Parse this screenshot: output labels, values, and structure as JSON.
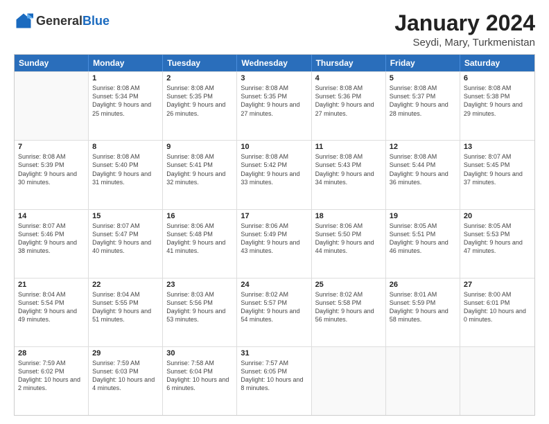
{
  "header": {
    "logo_general": "General",
    "logo_blue": "Blue",
    "month_title": "January 2024",
    "location": "Seydi, Mary, Turkmenistan"
  },
  "days_of_week": [
    "Sunday",
    "Monday",
    "Tuesday",
    "Wednesday",
    "Thursday",
    "Friday",
    "Saturday"
  ],
  "rows": [
    [
      {
        "day": "",
        "sunrise": "",
        "sunset": "",
        "daylight": ""
      },
      {
        "day": "1",
        "sunrise": "Sunrise: 8:08 AM",
        "sunset": "Sunset: 5:34 PM",
        "daylight": "Daylight: 9 hours and 25 minutes."
      },
      {
        "day": "2",
        "sunrise": "Sunrise: 8:08 AM",
        "sunset": "Sunset: 5:35 PM",
        "daylight": "Daylight: 9 hours and 26 minutes."
      },
      {
        "day": "3",
        "sunrise": "Sunrise: 8:08 AM",
        "sunset": "Sunset: 5:35 PM",
        "daylight": "Daylight: 9 hours and 27 minutes."
      },
      {
        "day": "4",
        "sunrise": "Sunrise: 8:08 AM",
        "sunset": "Sunset: 5:36 PM",
        "daylight": "Daylight: 9 hours and 27 minutes."
      },
      {
        "day": "5",
        "sunrise": "Sunrise: 8:08 AM",
        "sunset": "Sunset: 5:37 PM",
        "daylight": "Daylight: 9 hours and 28 minutes."
      },
      {
        "day": "6",
        "sunrise": "Sunrise: 8:08 AM",
        "sunset": "Sunset: 5:38 PM",
        "daylight": "Daylight: 9 hours and 29 minutes."
      }
    ],
    [
      {
        "day": "7",
        "sunrise": "Sunrise: 8:08 AM",
        "sunset": "Sunset: 5:39 PM",
        "daylight": "Daylight: 9 hours and 30 minutes."
      },
      {
        "day": "8",
        "sunrise": "Sunrise: 8:08 AM",
        "sunset": "Sunset: 5:40 PM",
        "daylight": "Daylight: 9 hours and 31 minutes."
      },
      {
        "day": "9",
        "sunrise": "Sunrise: 8:08 AM",
        "sunset": "Sunset: 5:41 PM",
        "daylight": "Daylight: 9 hours and 32 minutes."
      },
      {
        "day": "10",
        "sunrise": "Sunrise: 8:08 AM",
        "sunset": "Sunset: 5:42 PM",
        "daylight": "Daylight: 9 hours and 33 minutes."
      },
      {
        "day": "11",
        "sunrise": "Sunrise: 8:08 AM",
        "sunset": "Sunset: 5:43 PM",
        "daylight": "Daylight: 9 hours and 34 minutes."
      },
      {
        "day": "12",
        "sunrise": "Sunrise: 8:08 AM",
        "sunset": "Sunset: 5:44 PM",
        "daylight": "Daylight: 9 hours and 36 minutes."
      },
      {
        "day": "13",
        "sunrise": "Sunrise: 8:07 AM",
        "sunset": "Sunset: 5:45 PM",
        "daylight": "Daylight: 9 hours and 37 minutes."
      }
    ],
    [
      {
        "day": "14",
        "sunrise": "Sunrise: 8:07 AM",
        "sunset": "Sunset: 5:46 PM",
        "daylight": "Daylight: 9 hours and 38 minutes."
      },
      {
        "day": "15",
        "sunrise": "Sunrise: 8:07 AM",
        "sunset": "Sunset: 5:47 PM",
        "daylight": "Daylight: 9 hours and 40 minutes."
      },
      {
        "day": "16",
        "sunrise": "Sunrise: 8:06 AM",
        "sunset": "Sunset: 5:48 PM",
        "daylight": "Daylight: 9 hours and 41 minutes."
      },
      {
        "day": "17",
        "sunrise": "Sunrise: 8:06 AM",
        "sunset": "Sunset: 5:49 PM",
        "daylight": "Daylight: 9 hours and 43 minutes."
      },
      {
        "day": "18",
        "sunrise": "Sunrise: 8:06 AM",
        "sunset": "Sunset: 5:50 PM",
        "daylight": "Daylight: 9 hours and 44 minutes."
      },
      {
        "day": "19",
        "sunrise": "Sunrise: 8:05 AM",
        "sunset": "Sunset: 5:51 PM",
        "daylight": "Daylight: 9 hours and 46 minutes."
      },
      {
        "day": "20",
        "sunrise": "Sunrise: 8:05 AM",
        "sunset": "Sunset: 5:53 PM",
        "daylight": "Daylight: 9 hours and 47 minutes."
      }
    ],
    [
      {
        "day": "21",
        "sunrise": "Sunrise: 8:04 AM",
        "sunset": "Sunset: 5:54 PM",
        "daylight": "Daylight: 9 hours and 49 minutes."
      },
      {
        "day": "22",
        "sunrise": "Sunrise: 8:04 AM",
        "sunset": "Sunset: 5:55 PM",
        "daylight": "Daylight: 9 hours and 51 minutes."
      },
      {
        "day": "23",
        "sunrise": "Sunrise: 8:03 AM",
        "sunset": "Sunset: 5:56 PM",
        "daylight": "Daylight: 9 hours and 53 minutes."
      },
      {
        "day": "24",
        "sunrise": "Sunrise: 8:02 AM",
        "sunset": "Sunset: 5:57 PM",
        "daylight": "Daylight: 9 hours and 54 minutes."
      },
      {
        "day": "25",
        "sunrise": "Sunrise: 8:02 AM",
        "sunset": "Sunset: 5:58 PM",
        "daylight": "Daylight: 9 hours and 56 minutes."
      },
      {
        "day": "26",
        "sunrise": "Sunrise: 8:01 AM",
        "sunset": "Sunset: 5:59 PM",
        "daylight": "Daylight: 9 hours and 58 minutes."
      },
      {
        "day": "27",
        "sunrise": "Sunrise: 8:00 AM",
        "sunset": "Sunset: 6:01 PM",
        "daylight": "Daylight: 10 hours and 0 minutes."
      }
    ],
    [
      {
        "day": "28",
        "sunrise": "Sunrise: 7:59 AM",
        "sunset": "Sunset: 6:02 PM",
        "daylight": "Daylight: 10 hours and 2 minutes."
      },
      {
        "day": "29",
        "sunrise": "Sunrise: 7:59 AM",
        "sunset": "Sunset: 6:03 PM",
        "daylight": "Daylight: 10 hours and 4 minutes."
      },
      {
        "day": "30",
        "sunrise": "Sunrise: 7:58 AM",
        "sunset": "Sunset: 6:04 PM",
        "daylight": "Daylight: 10 hours and 6 minutes."
      },
      {
        "day": "31",
        "sunrise": "Sunrise: 7:57 AM",
        "sunset": "Sunset: 6:05 PM",
        "daylight": "Daylight: 10 hours and 8 minutes."
      },
      {
        "day": "",
        "sunrise": "",
        "sunset": "",
        "daylight": ""
      },
      {
        "day": "",
        "sunrise": "",
        "sunset": "",
        "daylight": ""
      },
      {
        "day": "",
        "sunrise": "",
        "sunset": "",
        "daylight": ""
      }
    ]
  ]
}
